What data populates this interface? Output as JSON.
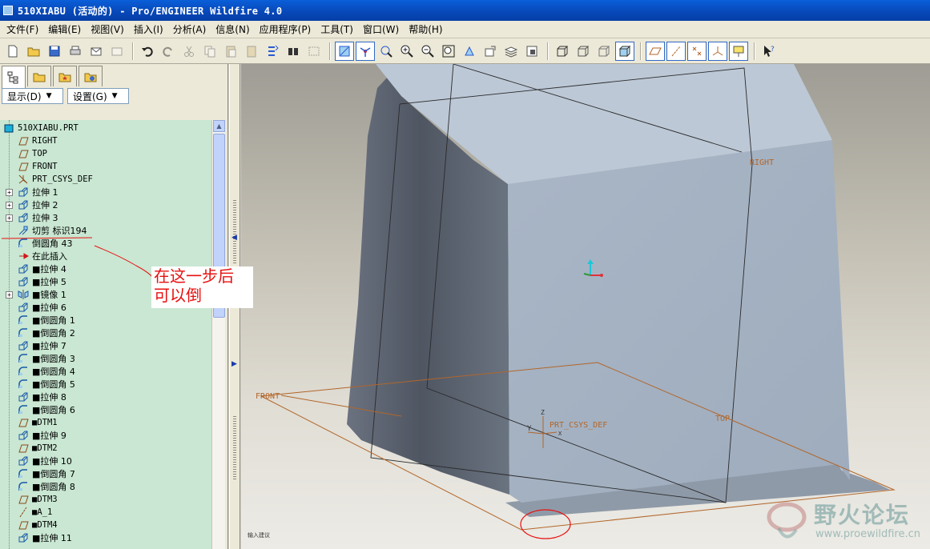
{
  "window": {
    "title": "510XIABU (活动的) - Pro/ENGINEER Wildfire 4.0"
  },
  "menu": [
    "文件(F)",
    "编辑(E)",
    "视图(V)",
    "插入(I)",
    "分析(A)",
    "信息(N)",
    "应用程序(P)",
    "工具(T)",
    "窗口(W)",
    "帮助(H)"
  ],
  "panel": {
    "display_label": "显示(D)",
    "settings_label": "设置(G)"
  },
  "tree": {
    "items": [
      {
        "label": "510XIABU.PRT",
        "icon": "part-icon",
        "expand": false,
        "indent": 0
      },
      {
        "label": "RIGHT",
        "icon": "datum-plane-icon",
        "expand": false,
        "indent": 1
      },
      {
        "label": "TOP",
        "icon": "datum-plane-icon",
        "expand": false,
        "indent": 1
      },
      {
        "label": "FRONT",
        "icon": "datum-plane-icon",
        "expand": false,
        "indent": 1
      },
      {
        "label": "PRT_CSYS_DEF",
        "icon": "csys-icon",
        "expand": false,
        "indent": 1
      },
      {
        "label": "拉伸 1",
        "icon": "extrude-icon",
        "expand": true,
        "indent": 1
      },
      {
        "label": "拉伸 2",
        "icon": "extrude-icon",
        "expand": true,
        "indent": 1
      },
      {
        "label": "拉伸 3",
        "icon": "extrude-icon",
        "expand": true,
        "indent": 1
      },
      {
        "label": "切剪 标识194",
        "icon": "cut-icon",
        "expand": false,
        "indent": 1
      },
      {
        "label": "倒圆角 43",
        "icon": "round-icon",
        "expand": false,
        "indent": 1
      },
      {
        "label": "在此插入",
        "icon": "insert-here-arrow-icon",
        "expand": false,
        "indent": 1
      },
      {
        "label": "■拉伸 4",
        "icon": "extrude-icon",
        "expand": false,
        "indent": 1
      },
      {
        "label": "■拉伸 5",
        "icon": "extrude-icon",
        "expand": false,
        "indent": 1
      },
      {
        "label": "■镜像 1",
        "icon": "mirror-icon",
        "expand": true,
        "indent": 1
      },
      {
        "label": "■拉伸 6",
        "icon": "extrude-icon",
        "expand": false,
        "indent": 1
      },
      {
        "label": "■倒圆角 1",
        "icon": "round-icon",
        "expand": false,
        "indent": 1
      },
      {
        "label": "■倒圆角 2",
        "icon": "round-icon",
        "expand": false,
        "indent": 1
      },
      {
        "label": "■拉伸 7",
        "icon": "extrude-icon",
        "expand": false,
        "indent": 1
      },
      {
        "label": "■倒圆角 3",
        "icon": "round-icon",
        "expand": false,
        "indent": 1
      },
      {
        "label": "■倒圆角 4",
        "icon": "round-icon",
        "expand": false,
        "indent": 1
      },
      {
        "label": "■倒圆角 5",
        "icon": "round-icon",
        "expand": false,
        "indent": 1
      },
      {
        "label": "■拉伸 8",
        "icon": "extrude-icon",
        "expand": false,
        "indent": 1
      },
      {
        "label": "■倒圆角 6",
        "icon": "round-icon",
        "expand": false,
        "indent": 1
      },
      {
        "label": "■DTM1",
        "icon": "datum-plane-icon",
        "expand": false,
        "indent": 1
      },
      {
        "label": "■拉伸 9",
        "icon": "extrude-icon",
        "expand": false,
        "indent": 1
      },
      {
        "label": "■DTM2",
        "icon": "datum-plane-icon",
        "expand": false,
        "indent": 1
      },
      {
        "label": "■拉伸 10",
        "icon": "extrude-icon",
        "expand": false,
        "indent": 1
      },
      {
        "label": "■倒圆角 7",
        "icon": "round-icon",
        "expand": false,
        "indent": 1
      },
      {
        "label": "■倒圆角 8",
        "icon": "round-icon",
        "expand": false,
        "indent": 1
      },
      {
        "label": "■DTM3",
        "icon": "datum-plane-icon",
        "expand": false,
        "indent": 1
      },
      {
        "label": "■A_1",
        "icon": "datum-axis-icon",
        "expand": false,
        "indent": 1
      },
      {
        "label": "■DTM4",
        "icon": "datum-plane-icon",
        "expand": false,
        "indent": 1
      },
      {
        "label": "■拉伸 11",
        "icon": "extrude-icon",
        "expand": false,
        "indent": 1
      }
    ]
  },
  "annotation": {
    "line1": "在这一步后",
    "line2": "可以倒",
    "color": "#e81010"
  },
  "viewport": {
    "labels": {
      "right": "RIGHT",
      "front": "FRONT",
      "top": "TOP",
      "csys": "PRT_CSYS_DEF",
      "axis_z": "Z",
      "axis_y": "Y",
      "axis_x": "X"
    },
    "status": "输入建议",
    "colors": {
      "model": "#a6b4c4",
      "datum": "#b2662a",
      "highlight": "#e81010"
    }
  },
  "watermark": {
    "title": "野火论坛",
    "url": "www.proewildfire.cn"
  }
}
